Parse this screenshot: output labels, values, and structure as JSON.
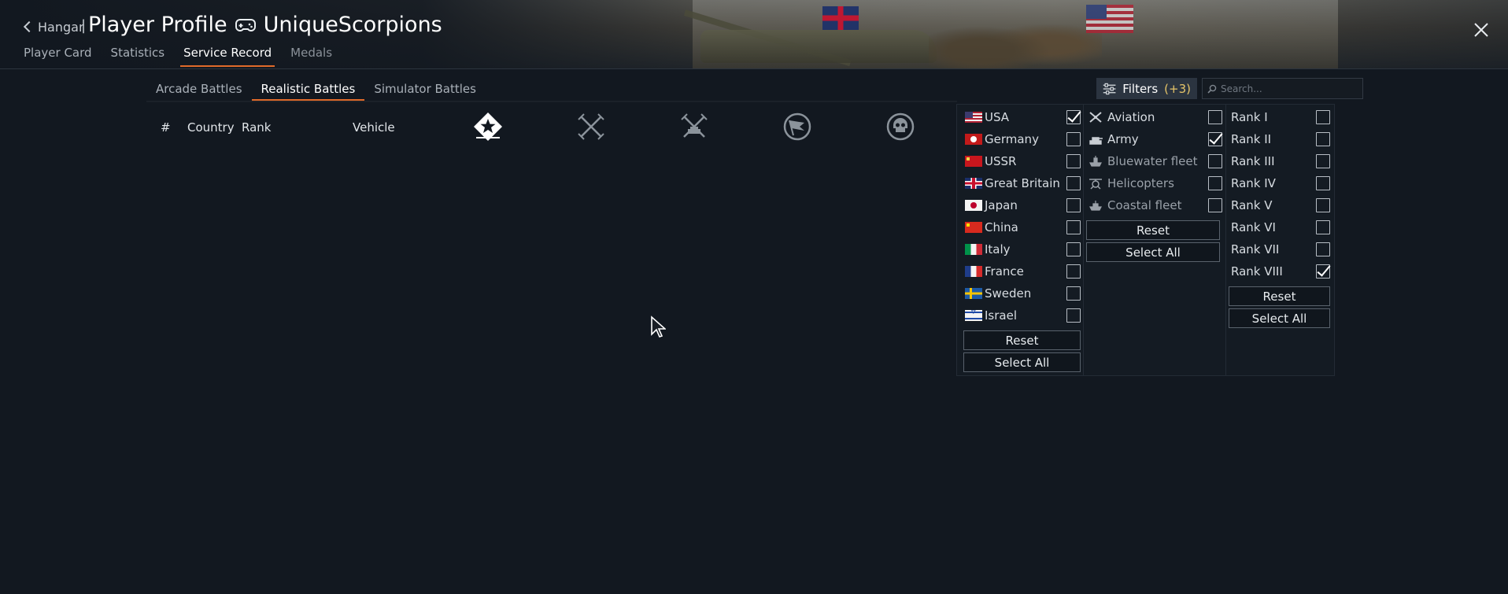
{
  "header": {
    "back_label": "Hangar",
    "separator": "|",
    "title": "Player Profile",
    "player_name": "UniqueScorpions",
    "close_icon": "close-icon"
  },
  "main_tabs": [
    {
      "label": "Player Card",
      "state": "normal"
    },
    {
      "label": "Statistics",
      "state": "normal"
    },
    {
      "label": "Service Record",
      "state": "active"
    },
    {
      "label": "Medals",
      "state": "dim"
    }
  ],
  "sub_tabs": [
    {
      "label": "Arcade Battles",
      "state": "normal"
    },
    {
      "label": "Realistic Battles",
      "state": "active"
    },
    {
      "label": "Simulator Battles",
      "state": "normal"
    }
  ],
  "table": {
    "columns": {
      "index": "#",
      "country": "Country",
      "rank": "Rank",
      "vehicle": "Vehicle"
    },
    "stat_icons": [
      "victory-star-icon",
      "crossed-swords-icon",
      "ground-kills-icon",
      "capture-flag-icon",
      "skull-icon"
    ]
  },
  "filters": {
    "label": "Filters",
    "count": "(+3)",
    "search_placeholder": "Search..."
  },
  "panel": {
    "countries": [
      {
        "label": "USA",
        "flag": "usa",
        "checked": true
      },
      {
        "label": "Germany",
        "flag": "germany",
        "checked": false
      },
      {
        "label": "USSR",
        "flag": "ussr",
        "checked": false
      },
      {
        "label": "Great Britain",
        "flag": "great-britain",
        "checked": false
      },
      {
        "label": "Japan",
        "flag": "japan",
        "checked": false
      },
      {
        "label": "China",
        "flag": "china",
        "checked": false
      },
      {
        "label": "Italy",
        "flag": "italy",
        "checked": false
      },
      {
        "label": "France",
        "flag": "france",
        "checked": false
      },
      {
        "label": "Sweden",
        "flag": "sweden",
        "checked": false
      },
      {
        "label": "Israel",
        "flag": "israel",
        "checked": false
      }
    ],
    "types": [
      {
        "label": "Aviation",
        "icon": "aviation-icon",
        "checked": false,
        "dim": false
      },
      {
        "label": "Army",
        "icon": "tank-icon",
        "checked": true,
        "dim": false
      },
      {
        "label": "Bluewater fleet",
        "icon": "ship-icon",
        "checked": false,
        "dim": true
      },
      {
        "label": "Helicopters",
        "icon": "helicopter-icon",
        "checked": false,
        "dim": true
      },
      {
        "label": "Coastal fleet",
        "icon": "boat-icon",
        "checked": false,
        "dim": true
      }
    ],
    "ranks": [
      {
        "label": "Rank I",
        "checked": false
      },
      {
        "label": "Rank II",
        "checked": false
      },
      {
        "label": "Rank III",
        "checked": false
      },
      {
        "label": "Rank IV",
        "checked": false
      },
      {
        "label": "Rank V",
        "checked": false
      },
      {
        "label": "Rank VI",
        "checked": false
      },
      {
        "label": "Rank VII",
        "checked": false
      },
      {
        "label": "Rank VIII",
        "checked": true
      }
    ],
    "reset_label": "Reset",
    "select_all_label": "Select All"
  }
}
